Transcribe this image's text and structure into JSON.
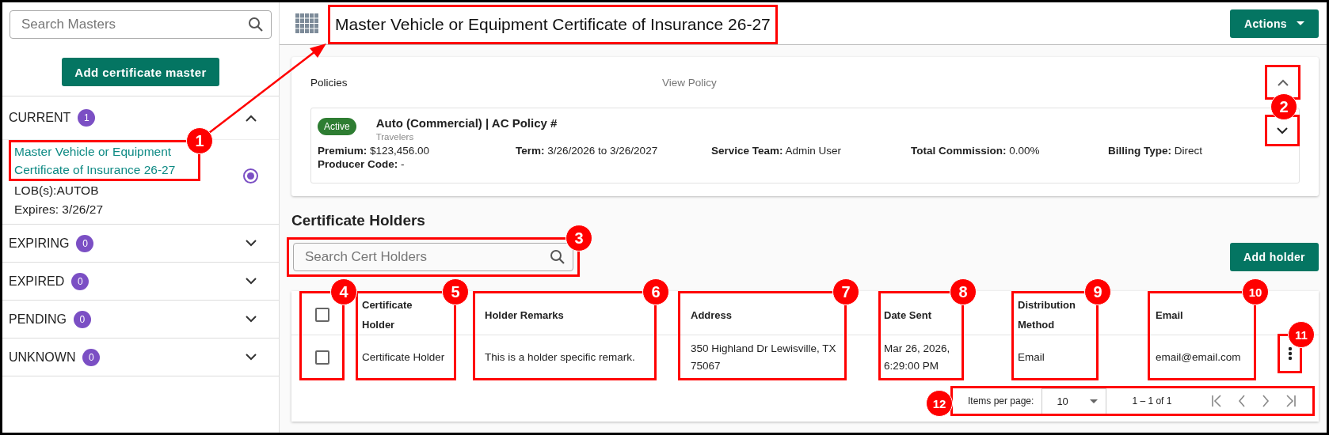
{
  "sidebar": {
    "search": {
      "placeholder": "Search Masters"
    },
    "add_button": "Add certificate master",
    "sections": [
      {
        "label": "CURRENT",
        "count": "1",
        "expanded": true,
        "items": [
          {
            "title": "Master Vehicle or Equipment Certificate of Insurance 26-27",
            "lob": "LOB(s):AUTOB",
            "expires": "Expires: 3/26/27",
            "selected": true
          }
        ]
      },
      {
        "label": "EXPIRING",
        "count": "0",
        "expanded": false
      },
      {
        "label": "EXPIRED",
        "count": "0",
        "expanded": false
      },
      {
        "label": "PENDING",
        "count": "0",
        "expanded": false
      },
      {
        "label": "UNKNOWN",
        "count": "0",
        "expanded": false
      }
    ]
  },
  "header": {
    "title": "Master Vehicle or Equipment Certificate of Insurance 26-27",
    "actions_button": "Actions"
  },
  "policies": {
    "label": "Policies",
    "link": "View Policy",
    "expanded": true,
    "policy": {
      "status": "Active",
      "name": "Auto (Commercial) | AC Policy #",
      "carrier": "Travelers",
      "expanded": false,
      "fields": [
        {
          "label": "Premium:",
          "value": "$123,456.00"
        },
        {
          "label": "Term:",
          "value": "3/26/2026 to 3/26/2027"
        },
        {
          "label": "Service Team:",
          "value": "Admin User"
        },
        {
          "label": "Total Commission:",
          "value": "0.00%"
        },
        {
          "label": "Billing Type:",
          "value": "Direct"
        },
        {
          "label": "Producer Code:",
          "value": "-"
        }
      ]
    }
  },
  "holders": {
    "title": "Certificate Holders",
    "search": {
      "placeholder": "Search Cert Holders"
    },
    "add_button": "Add holder",
    "table": {
      "select_all": {
        "checked": false
      },
      "columns": [
        "Certificate Holder",
        "Holder Remarks",
        "Address",
        "Date Sent",
        "Distribution Method",
        "Email"
      ],
      "rows": [
        {
          "checked": false,
          "cells": [
            "Certificate Holder",
            "This is a holder specific remark.",
            "350 Highland Dr Lewisville, TX 75067",
            "Mar 26, 2026, 6:29:00 PM",
            "Email",
            "email@email.com"
          ]
        }
      ]
    },
    "paginator": {
      "label": "Items per page:",
      "page_size": "10",
      "range": "1 – 1 of 1"
    }
  },
  "annotations": [
    {
      "number": "1"
    },
    {
      "number": "2"
    },
    {
      "number": "3"
    },
    {
      "number": "4"
    },
    {
      "number": "5"
    },
    {
      "number": "6"
    },
    {
      "number": "7"
    },
    {
      "number": "8"
    },
    {
      "number": "9"
    },
    {
      "number": "10"
    },
    {
      "number": "11"
    },
    {
      "number": "12"
    }
  ]
}
